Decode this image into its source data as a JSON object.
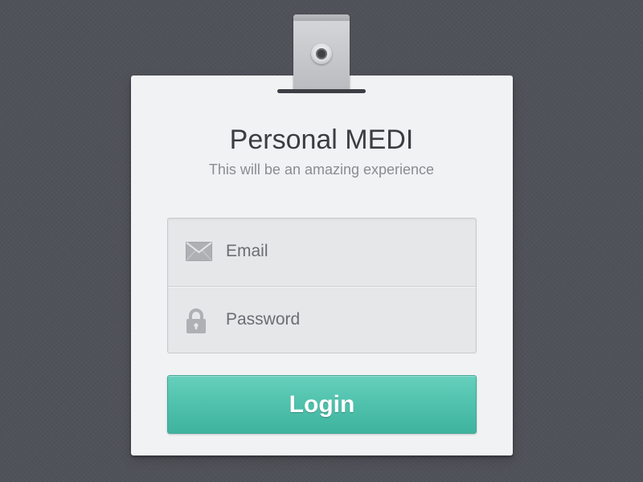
{
  "app": {
    "title": "Personal MEDI",
    "subtitle": "This will be an amazing experience"
  },
  "form": {
    "email": {
      "placeholder": "Email",
      "value": "",
      "icon": "envelope-icon"
    },
    "password": {
      "placeholder": "Password",
      "value": "",
      "icon": "lock-icon"
    },
    "login_label": "Login"
  },
  "colors": {
    "background": "#505259",
    "card": "#f1f2f4",
    "field_background": "#e6e7e9",
    "accent": "#4fc1ac",
    "title_text": "#3b3d42",
    "subtitle_text": "#8a8c91"
  }
}
